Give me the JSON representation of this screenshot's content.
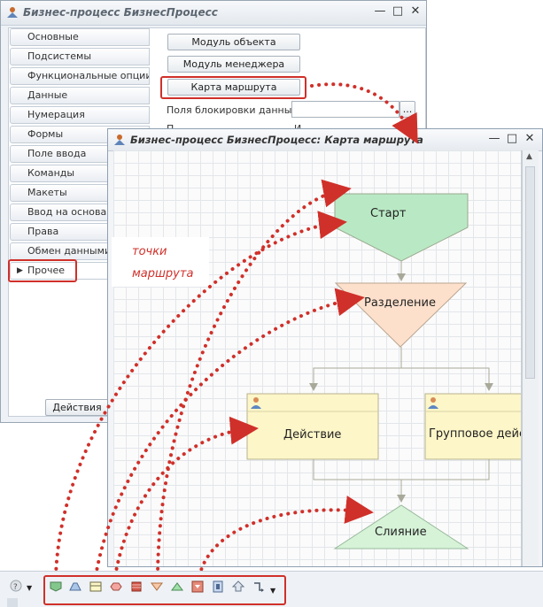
{
  "process_window": {
    "title": "Бизнес-процесс БизнесПроцесс",
    "tabs": [
      "Основные",
      "Подсистемы",
      "Функциональные опции",
      "Данные",
      "Нумерация",
      "Формы",
      "Поле ввода",
      "Команды",
      "Макеты",
      "Ввод на основании",
      "Права",
      "Обмен данными",
      "Прочее"
    ],
    "active_tab": "Прочее",
    "buttons": {
      "object_module": "Модуль объекта",
      "manager_module": "Модуль менеджера",
      "route_map": "Карта маршрута",
      "actions": "Действия"
    },
    "lock_fields_label": "Поля блокировки данных:",
    "lock_fields_value": "",
    "lock_fields_btn": "...",
    "hidden_label_fragment": "П",
    "hidden_value_fragment": "И"
  },
  "route_map_window": {
    "title": "Бизнес-процесс БизнесПроцесс: Карта маршрута",
    "nodes": {
      "start": "Старт",
      "split": "Разделение",
      "action": "Действие",
      "group_action": "Групповое дейст",
      "merge": "Слияние"
    }
  },
  "annotation": {
    "line1": "точки",
    "line2": "маршрута",
    "color": "#d0302a"
  },
  "toolbar": {
    "left_icon": "help-icon",
    "icons": [
      "start-point-icon",
      "point-icon",
      "action-icon",
      "condition-icon",
      "subprocess-icon",
      "split-icon",
      "merge-icon",
      "processing-icon",
      "stop-icon",
      "switch-icon",
      "connection-icon"
    ]
  },
  "colors": {
    "start_fill": "#b9e9c4",
    "split_fill": "#fde0cc",
    "action_fill": "#fdf6c8",
    "merge_fill": "#d6f3d8",
    "accent_red": "#d0302a"
  }
}
